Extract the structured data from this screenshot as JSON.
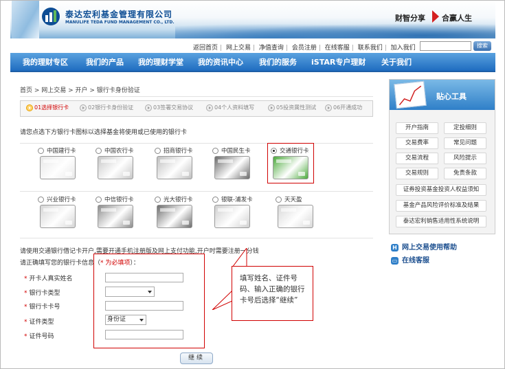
{
  "header": {
    "logo_cn": "泰达宏利基金管理有限公司",
    "logo_en": "MANULIFE TEDA FUND MANAGEMENT CO., LTD.",
    "slogan_left": "财智分享",
    "slogan_right": "合赢人生"
  },
  "toplinks": [
    "返回首页",
    "网上交易",
    "净值查询",
    "会员注册",
    "在线客服",
    "联系我们",
    "加入我们"
  ],
  "search": {
    "button": "搜索",
    "value": ""
  },
  "nav": [
    "我的理财专区",
    "我们的产品",
    "我的理财学堂",
    "我的资讯中心",
    "我们的服务",
    "iSTAR专户理财",
    "关于我们"
  ],
  "breadcrumb": "首页 > 网上交易 > 开户 > 银行卡身份验证",
  "steps": [
    "01选择银行卡",
    "02银行卡身份验证",
    "03签署交易协议",
    "04个人资料填写",
    "05投资属性测试",
    "06开通成功"
  ],
  "instruction": "请您点选下方银行卡图标以选择基金将使用或已使用的银行卡",
  "banks_row1": [
    "中国建行卡",
    "中国农行卡",
    "招商银行卡",
    "中国民生卡",
    "交通银行卡"
  ],
  "banks_row2": [
    "兴业银行卡",
    "中信银行卡",
    "光大银行卡",
    "银联-浦发卡",
    "天天盈"
  ],
  "card_colors_row1": [
    "#e7e7e7",
    "#c7c7c7",
    "#bfbfbf",
    "#6b6b6b",
    "#4caa3c"
  ],
  "card_colors_row2": [
    "#d5d5d5",
    "#8c8c8c",
    "#6c6c6c",
    "#cfcfcf",
    "#d8d8d8"
  ],
  "form": {
    "note1": "请使用交通银行借记卡开户,需要开通手机注册版及网上支付功能,开户时需要注册一分钱",
    "note2_prefix": "请正确填写您的银行卡信息（",
    "note2_required": "* 为必填项",
    "note2_suffix": "）：",
    "fields": [
      "开卡人真实姓名",
      "银行卡类型",
      "银行卡卡号",
      "证件类型",
      "证件号码"
    ],
    "id_type_value": "身份证",
    "continue": "继续"
  },
  "callout": "填写姓名、证件号码、输入正确的银行卡号后选择“继续”",
  "sidebar": {
    "title": "贴心工具",
    "grid": [
      "开户指南",
      "定投细则",
      "交易费率",
      "常见问题",
      "交易流程",
      "风险提示",
      "交易规则",
      "免责条款"
    ],
    "wide": [
      "证券投资基金投资人权益须知",
      "基金产品风险评价标准及结果",
      "泰达宏利销售适用性系统说明"
    ],
    "links": [
      "网上交易使用帮助",
      "在线客服"
    ]
  }
}
